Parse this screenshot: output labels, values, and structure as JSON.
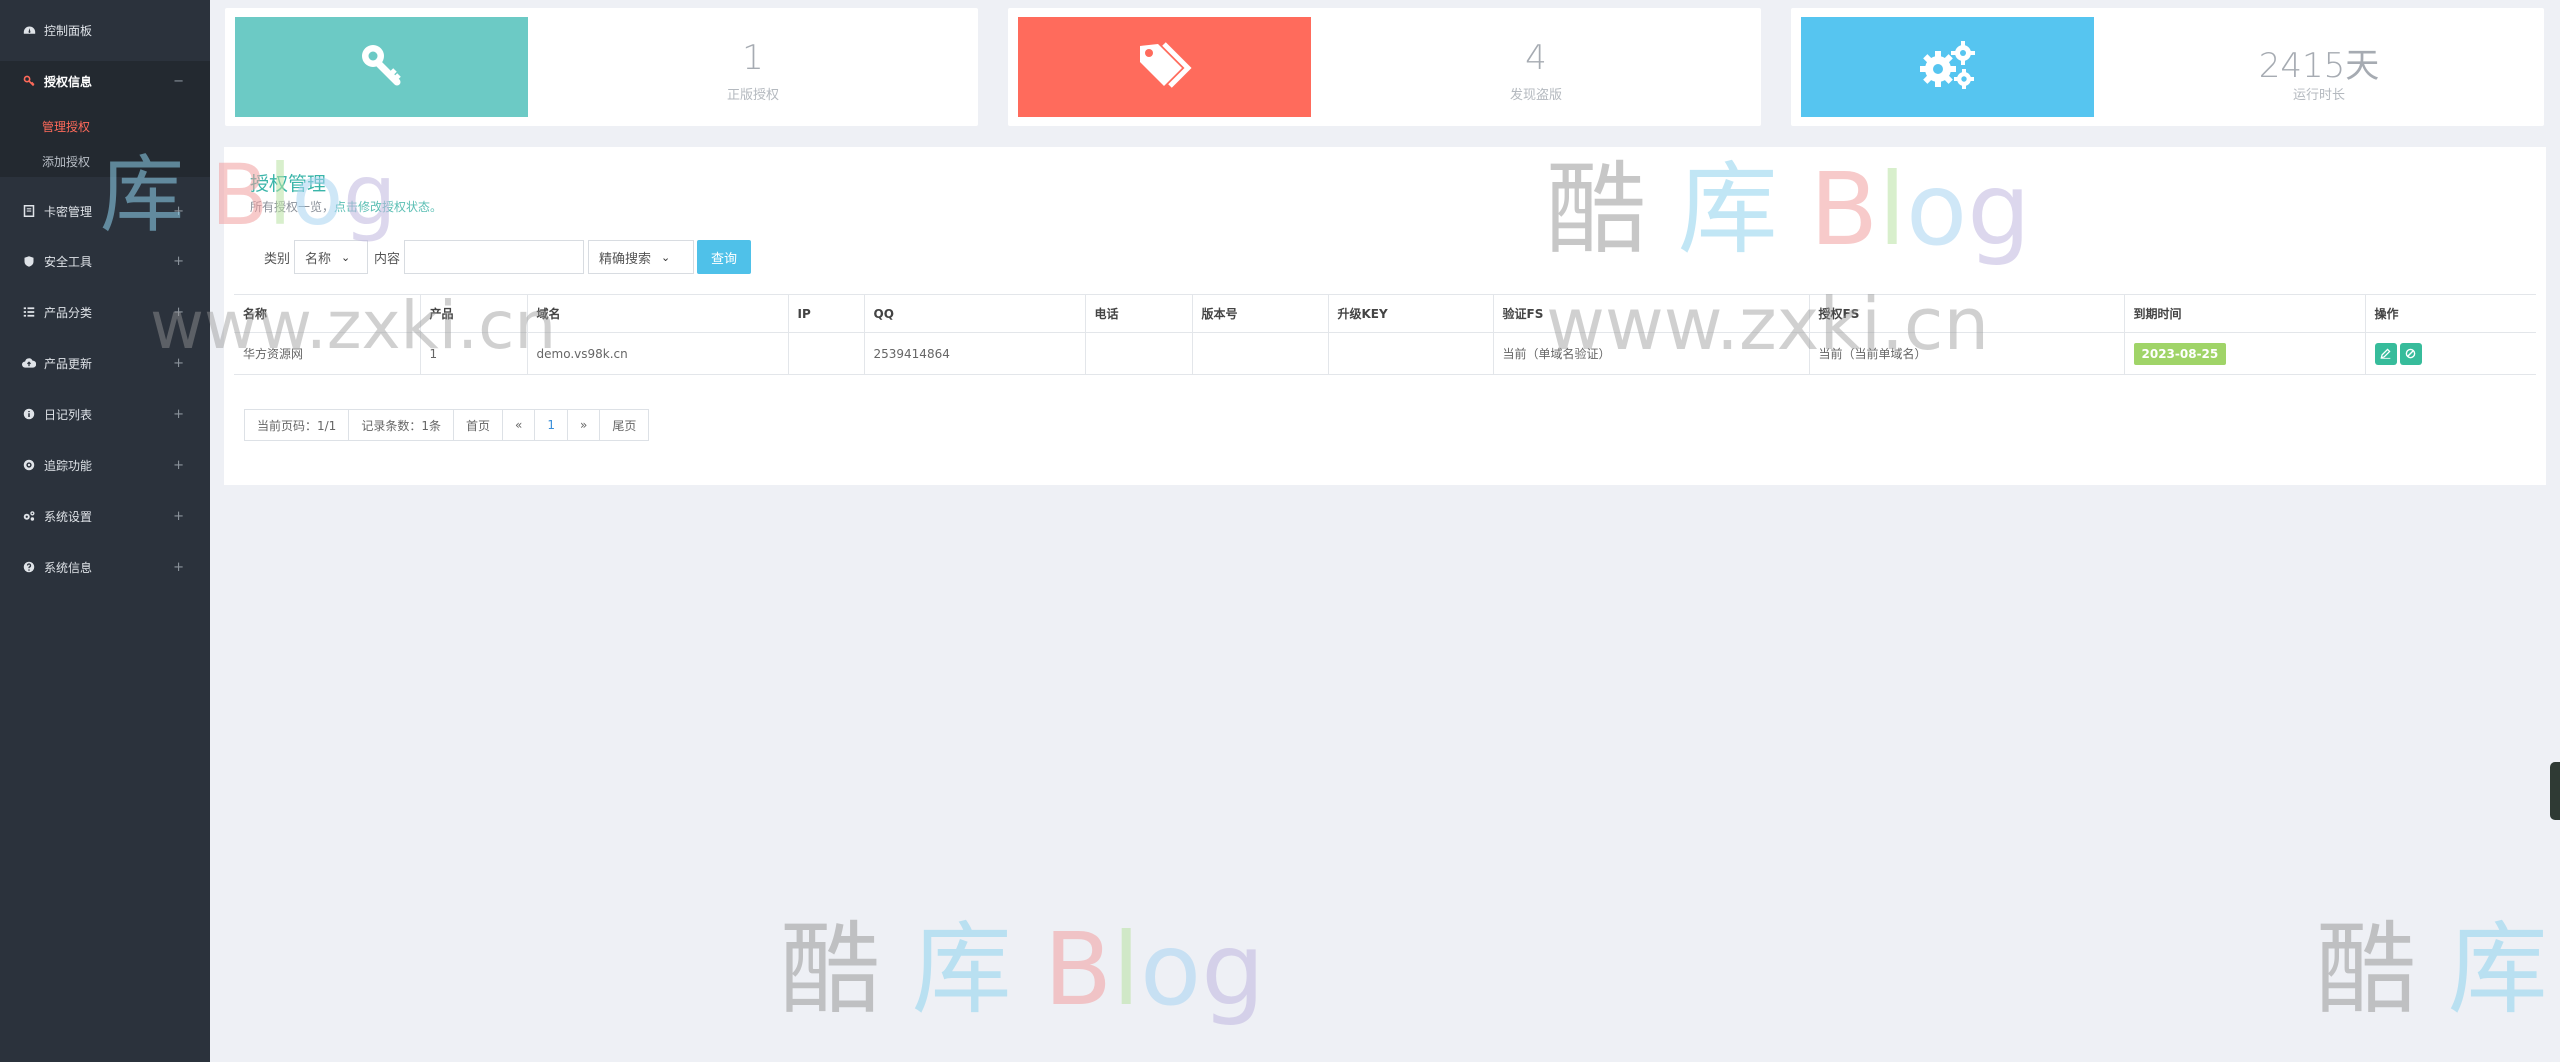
{
  "sidebar": {
    "items": [
      {
        "label": "控制面板",
        "icon": "dashboard-icon"
      },
      {
        "label": "授权信息",
        "icon": "key-icon",
        "toggle": "−"
      },
      {
        "label": "卡密管理",
        "icon": "card-icon",
        "toggle": "+"
      },
      {
        "label": "安全工具",
        "icon": "shield-icon",
        "toggle": "+"
      },
      {
        "label": "产品分类",
        "icon": "list-icon",
        "toggle": "+"
      },
      {
        "label": "产品更新",
        "icon": "cloud-upload-icon",
        "toggle": "+"
      },
      {
        "label": "日记列表",
        "icon": "info-icon",
        "toggle": "+"
      },
      {
        "label": "追踪功能",
        "icon": "target-icon",
        "toggle": "+"
      },
      {
        "label": "系统设置",
        "icon": "cogs-icon",
        "toggle": "+"
      },
      {
        "label": "系统信息",
        "icon": "question-icon",
        "toggle": "+"
      }
    ],
    "subitems": [
      {
        "label": "管理授权",
        "active": true
      },
      {
        "label": "添加授权",
        "active": false
      }
    ]
  },
  "stats": [
    {
      "value": "1",
      "caption": "正版授权",
      "color": "#6ccac5",
      "icon": "key-icon"
    },
    {
      "value": "4",
      "caption": "发现盗版",
      "color": "#ff6b5c",
      "icon": "tags-icon"
    },
    {
      "value": "2415天",
      "caption": "运行时长",
      "color": "#56c5f0",
      "icon": "cogs-icon"
    }
  ],
  "panel": {
    "title": "授权管理",
    "subtitle_prefix": "所有授权一览，",
    "subtitle_highlight": "点击修改授权状态。"
  },
  "search": {
    "category_label": "类别",
    "category_value": "名称",
    "content_label": "内容",
    "content_value": "",
    "mode_value": "精确搜索",
    "button_label": "查询"
  },
  "table": {
    "columns": [
      "名称",
      "产品",
      "域名",
      "IP",
      "QQ",
      "电话",
      "版本号",
      "升级KEY",
      "验证FS",
      "授权FS",
      "到期时间",
      "操作"
    ],
    "rows": [
      {
        "name": "华方资源网",
        "product": "1",
        "domain": "demo.vs98k.cn",
        "ip": "",
        "qq": "2539414864",
        "phone": "",
        "version": "",
        "upgrade_key": "",
        "verify_fs": "当前（单域名验证）",
        "auth_fs": "当前（当前单域名）",
        "expires": "2023-08-25"
      }
    ]
  },
  "pager": {
    "current": "当前页码：1/1",
    "records": "记录条数：1条",
    "first": "首页",
    "prev": "«",
    "page": "1",
    "next": "»",
    "last": "尾页"
  },
  "watermark": {
    "logo_cn_1": "酷",
    "logo_cn_2": "库",
    "logo_b": "B",
    "logo_l": "l",
    "logo_o": "o",
    "logo_g": "g",
    "url": "www.zxki.cn"
  }
}
